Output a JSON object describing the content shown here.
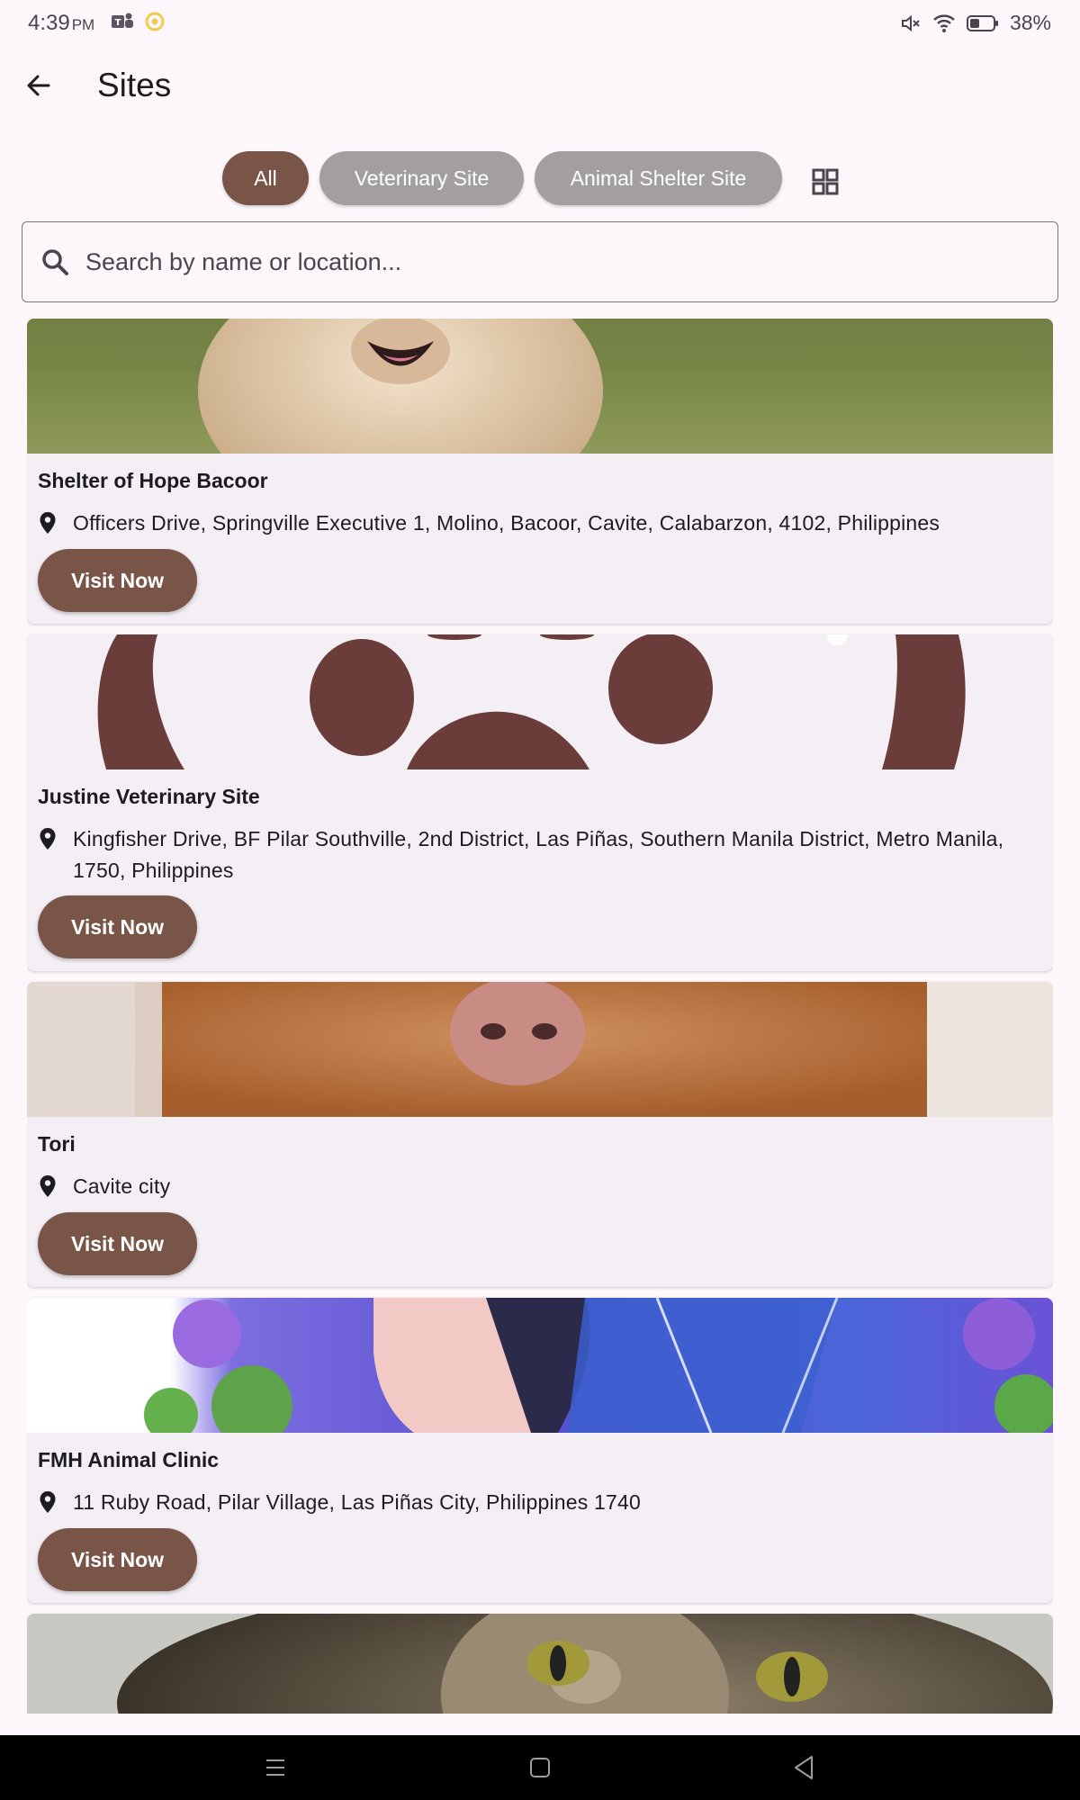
{
  "status_bar": {
    "time": "4:39",
    "ampm": "PM",
    "battery": "38%"
  },
  "header": {
    "title": "Sites"
  },
  "filters": {
    "chips": [
      {
        "label": "All",
        "selected": true
      },
      {
        "label": "Veterinary Site",
        "selected": false
      },
      {
        "label": "Animal Shelter Site",
        "selected": false
      }
    ]
  },
  "search": {
    "placeholder": "Search by name or location...",
    "value": ""
  },
  "sites": [
    {
      "name": "Shelter of Hope Bacoor",
      "address": "Officers Drive, Springville Executive 1, Molino, Bacoor, Cavite, Calabarzon, 4102, Philippines",
      "button": "Visit Now"
    },
    {
      "name": "Justine Veterinary Site",
      "address": "Kingfisher Drive, BF Pilar Southville, 2nd District, Las Piñas, Southern Manila District, Metro Manila, 1750, Philippines",
      "button": "Visit Now"
    },
    {
      "name": "Tori",
      "address": "Cavite city",
      "button": "Visit Now"
    },
    {
      "name": "FMH Animal Clinic",
      "address": "11 Ruby Road, Pilar Village, Las Piñas City, Philippines 1740",
      "button": "Visit Now"
    }
  ],
  "colors": {
    "accent": "#795548",
    "chip_inactive": "#a39fa1",
    "background": "#fdf7fc",
    "card": "#f4eef5"
  },
  "icons": {
    "back": "arrow-left-icon",
    "view_toggle": "grid-icon",
    "search": "search-icon",
    "location": "location-pin-icon"
  }
}
